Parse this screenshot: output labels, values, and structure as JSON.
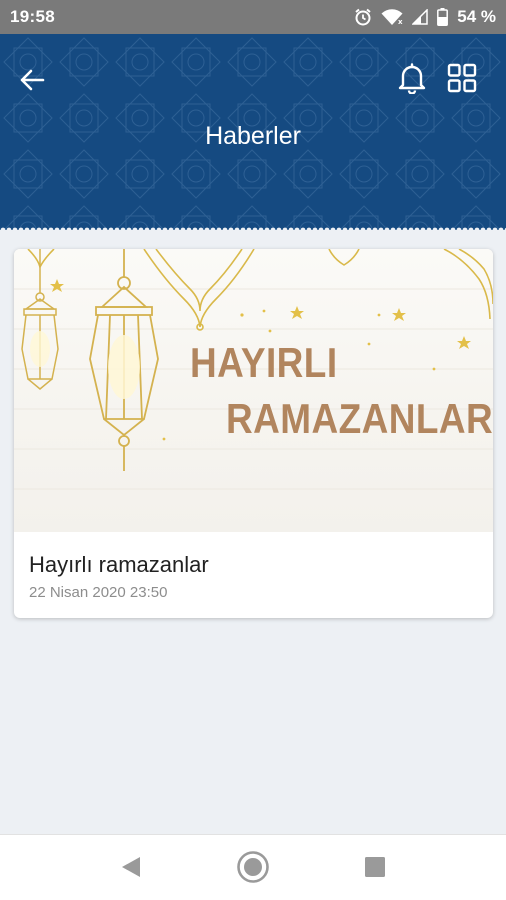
{
  "status_bar": {
    "time": "19:58",
    "battery": "54 %",
    "icons": [
      "alarm-icon",
      "wifi-icon",
      "signal-icon",
      "battery-icon"
    ]
  },
  "header": {
    "title": "Haberler",
    "background_color": "#154a81",
    "icons": [
      "back-arrow-icon",
      "bell-icon",
      "grid-icon"
    ]
  },
  "news": [
    {
      "banner_line1": "HAYIRLI",
      "banner_line2": "RAMAZANLAR",
      "title": "Hayırlı ramazanlar",
      "date": "22 Nisan 2020 23:50"
    }
  ],
  "nav_bar": {
    "icons": [
      "back-triangle-icon",
      "home-circle-icon",
      "recents-square-icon"
    ]
  },
  "colors": {
    "accent": "#154a81",
    "banner_text": "#b1855e",
    "ornament_gold": "#d9b94a"
  }
}
